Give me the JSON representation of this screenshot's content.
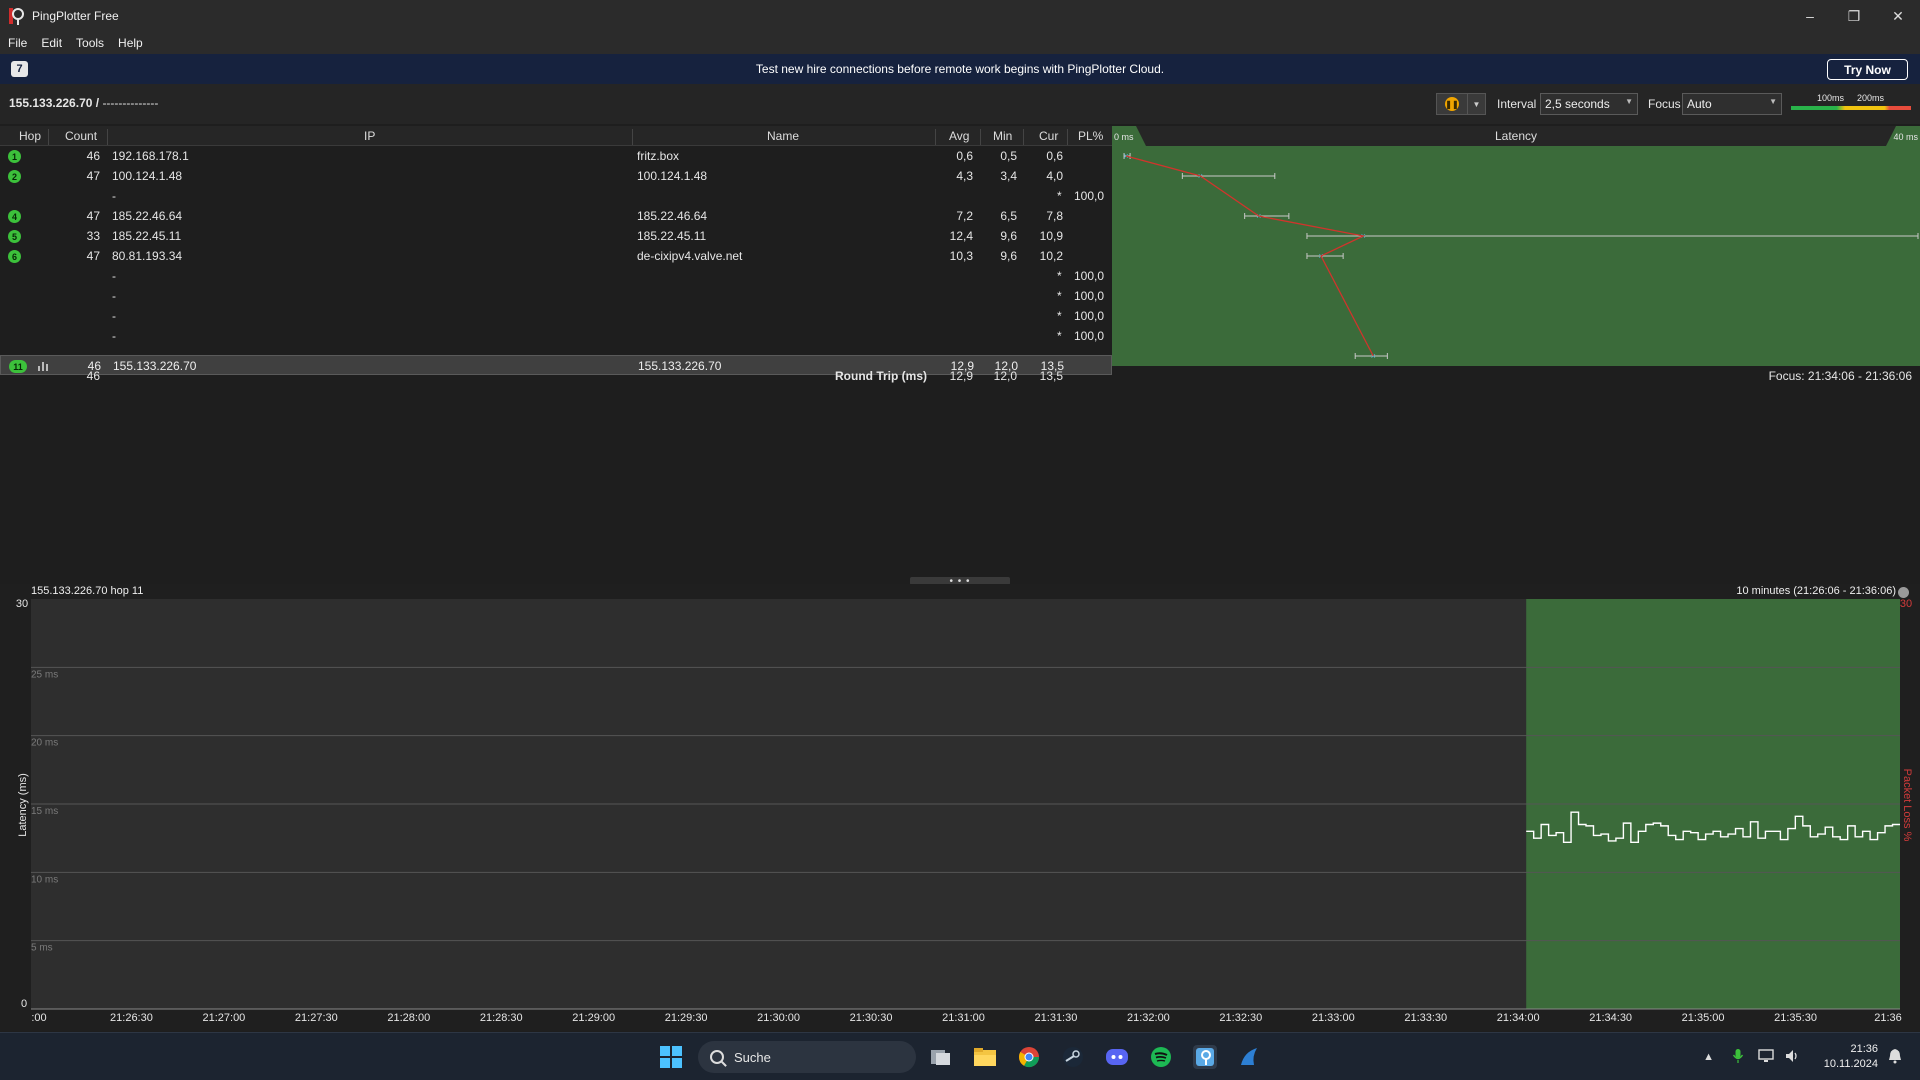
{
  "window": {
    "title": "PingPlotter Free",
    "min": "–",
    "restore": "❐",
    "close": "✕"
  },
  "menu": [
    "File",
    "Edit",
    "Tools",
    "Help"
  ],
  "banner": {
    "message": "Test new hire connections before remote work begins with PingPlotter Cloud.",
    "cta": "Try Now"
  },
  "toolbar": {
    "target": "155.133.226.70 /",
    "target_name": "--------------",
    "interval_label": "Interval",
    "interval_value": "2,5 seconds",
    "focus_label": "Focus",
    "focus_value": "Auto",
    "scale_100": "100ms",
    "scale_200": "200ms"
  },
  "table": {
    "headers": {
      "hop": "Hop",
      "count": "Count",
      "ip": "IP",
      "name": "Name",
      "avg": "Avg",
      "min": "Min",
      "cur": "Cur",
      "pl": "PL%"
    },
    "latency_header": "Latency",
    "latency_min_label": "0 ms",
    "latency_max_label": "40 ms",
    "rows": [
      {
        "hop": "1",
        "count": "46",
        "ip": "192.168.178.1",
        "name": "fritz.box",
        "avg": "0,6",
        "min": "0,5",
        "cur": "0,6",
        "star": "",
        "pl": ""
      },
      {
        "hop": "2",
        "count": "47",
        "ip": "100.124.1.48",
        "name": "100.124.1.48",
        "avg": "4,3",
        "min": "3,4",
        "cur": "4,0",
        "star": "",
        "pl": ""
      },
      {
        "hop": "",
        "count": "",
        "ip": "-",
        "name": "",
        "avg": "",
        "min": "",
        "cur": "",
        "star": "*",
        "pl": "100,0"
      },
      {
        "hop": "4",
        "count": "47",
        "ip": "185.22.46.64",
        "name": "185.22.46.64",
        "avg": "7,2",
        "min": "6,5",
        "cur": "7,8",
        "star": "",
        "pl": ""
      },
      {
        "hop": "5",
        "count": "33",
        "ip": "185.22.45.11",
        "name": "185.22.45.11",
        "avg": "12,4",
        "min": "9,6",
        "cur": "10,9",
        "star": "",
        "pl": ""
      },
      {
        "hop": "6",
        "count": "47",
        "ip": "80.81.193.34",
        "name": "de-cixipv4.valve.net",
        "avg": "10,3",
        "min": "9,6",
        "cur": "10,2",
        "star": "",
        "pl": ""
      },
      {
        "hop": "",
        "count": "",
        "ip": "-",
        "name": "",
        "avg": "",
        "min": "",
        "cur": "",
        "star": "*",
        "pl": "100,0"
      },
      {
        "hop": "",
        "count": "",
        "ip": "-",
        "name": "",
        "avg": "",
        "min": "",
        "cur": "",
        "star": "*",
        "pl": "100,0"
      },
      {
        "hop": "",
        "count": "",
        "ip": "-",
        "name": "",
        "avg": "",
        "min": "",
        "cur": "",
        "star": "*",
        "pl": "100,0"
      },
      {
        "hop": "",
        "count": "",
        "ip": "-",
        "name": "",
        "avg": "",
        "min": "",
        "cur": "",
        "star": "*",
        "pl": "100,0"
      },
      {
        "hop": "11",
        "count": "46",
        "ip": "155.133.226.70",
        "name": "155.133.226.70",
        "avg": "12,9",
        "min": "12,0",
        "cur": "13,5",
        "star": "",
        "pl": ""
      }
    ],
    "summary": {
      "count": "46",
      "label": "Round Trip (ms)",
      "avg": "12,9",
      "min": "12,0",
      "cur": "13,5",
      "focus": "Focus: 21:34:06 - 21:36:06"
    }
  },
  "timeline": {
    "title": "155.133.226.70 hop 11",
    "range": "10 minutes (21:26:06 - 21:36:06)",
    "ylabel": "Latency (ms)",
    "y2label": "Packet Loss %",
    "ymax_label": "30",
    "ymin_label": "0",
    "y2max_label": "30",
    "gridlabels": [
      "25 ms",
      "20 ms",
      "15 ms",
      "10 ms",
      "5 ms"
    ],
    "xlabels": [
      ":00",
      "21:26:30",
      "21:27:00",
      "21:27:30",
      "21:28:00",
      "21:28:30",
      "21:29:00",
      "21:29:30",
      "21:30:00",
      "21:30:30",
      "21:31:00",
      "21:31:30",
      "21:32:00",
      "21:32:30",
      "21:33:00",
      "21:33:30",
      "21:34:00",
      "21:34:30",
      "21:35:00",
      "21:35:30",
      "21:36"
    ]
  },
  "chart_data": [
    {
      "type": "scatter",
      "title": "Latency",
      "xlim": [
        0,
        40
      ],
      "xunit": "ms",
      "hops": [
        "1",
        "2",
        "",
        "4",
        "5",
        "6",
        "",
        "",
        "",
        "",
        "11"
      ],
      "avg": [
        0.6,
        4.3,
        null,
        7.2,
        12.4,
        10.3,
        null,
        null,
        null,
        null,
        12.9
      ],
      "min": [
        0.5,
        3.4,
        null,
        6.5,
        9.6,
        9.6,
        null,
        null,
        null,
        null,
        12.0
      ],
      "max": [
        0.8,
        8.0,
        null,
        8.7,
        40.0,
        11.4,
        null,
        null,
        null,
        null,
        13.6
      ]
    },
    {
      "type": "line",
      "title": "155.133.226.70 hop 11",
      "xlabel": "",
      "ylabel": "Latency (ms)",
      "ylim": [
        0,
        30
      ],
      "x_range": [
        "21:26:06",
        "21:36:06"
      ],
      "focus_range": [
        "21:34:06",
        "21:36:06"
      ],
      "series": [
        {
          "values": [
            13.0,
            12.5,
            13.5,
            12.7,
            12.9,
            12.2,
            14.4,
            13.5,
            13.4,
            12.7,
            12.8,
            12.3,
            12.5,
            13.6,
            12.2,
            13.0,
            13.5,
            13.6,
            13.4,
            12.7,
            12.4,
            13.0,
            12.9,
            12.4,
            12.8,
            13.0,
            12.6,
            12.8,
            13.2,
            12.6,
            13.7,
            12.5,
            13.0,
            13.0,
            12.4,
            13.2,
            14.1,
            13.4,
            12.6,
            12.8,
            13.3,
            12.6,
            12.4,
            13.4,
            12.6,
            13.0,
            12.4,
            12.9,
            13.4,
            13.5
          ]
        }
      ]
    }
  ]
}
